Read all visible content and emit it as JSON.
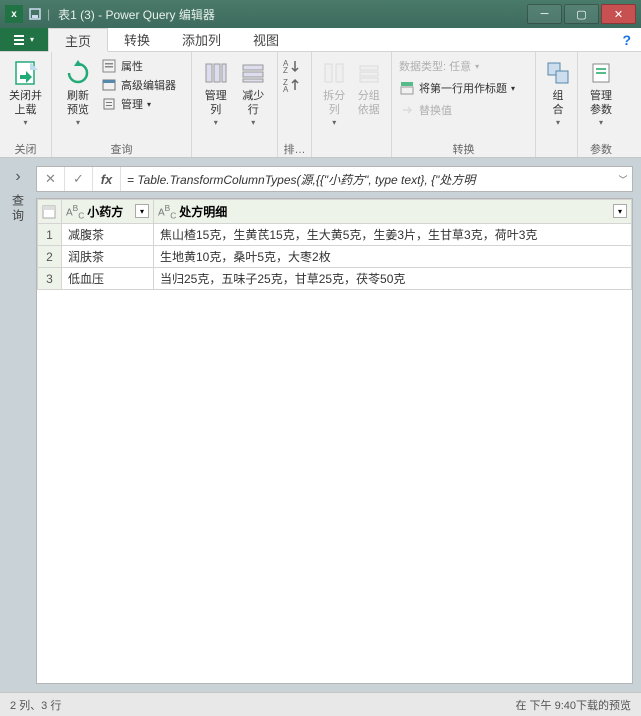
{
  "title": "表1 (3) - Power Query 编辑器",
  "tabs": {
    "home": "主页",
    "transform": "转换",
    "addcol": "添加列",
    "view": "视图"
  },
  "ribbon": {
    "close": {
      "btn": "关闭并\n上载",
      "label": "关闭"
    },
    "query": {
      "refresh": "刷新\n预览",
      "props": "属性",
      "adveditor": "高级编辑器",
      "manage": "管理",
      "label": "查询"
    },
    "cols": {
      "manage_cols": "管理\n列",
      "reduce_rows": "减少\n行"
    },
    "sort": {
      "label": "排…"
    },
    "split": {
      "split": "拆分\n列",
      "group": "分组\n依据"
    },
    "transform": {
      "datatype": "数据类型: 任意",
      "firstrow": "将第一行用作标题",
      "replace": "替换值",
      "label": "转换"
    },
    "combine": {
      "btn": "组\n合",
      "label": ""
    },
    "params": {
      "btn": "管理\n参数",
      "label": "参数"
    }
  },
  "sidebar": "查询",
  "formula": "= Table.TransformColumnTypes(源,{{\"小药方\", type text}, {\"处方明",
  "columns": [
    "小药方",
    "处方明细"
  ],
  "rows": [
    {
      "n": "1",
      "c1": "减腹茶",
      "c2": "焦山楂15克，生黄芪15克，生大黄5克，生姜3片，生甘草3克，荷叶3克"
    },
    {
      "n": "2",
      "c1": "润肤茶",
      "c2": "生地黄10克，桑叶5克，大枣2枚"
    },
    {
      "n": "3",
      "c1": "低血压",
      "c2": "当归25克，五味子25克，甘草25克，茯苓50克"
    }
  ],
  "status": {
    "left": "2 列、3 行",
    "right": "在 下午 9:40下载的预览"
  }
}
